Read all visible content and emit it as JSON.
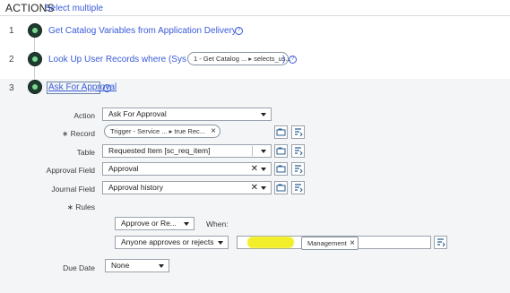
{
  "header": {
    "title": "ACTIONS",
    "select_multiple": "Select multiple"
  },
  "steps": [
    {
      "number": "1",
      "label": "Get Catalog Variables from Application Delivery"
    },
    {
      "number": "2",
      "label": "Look Up User Records where (Sys ID is one of",
      "pill_text": "1 - Get Catalog ... ▸ selects_us...",
      "suffix": ")"
    },
    {
      "number": "3",
      "label": "Ask For Approval"
    }
  ],
  "form": {
    "action": {
      "label": "Action",
      "value": "Ask For Approval"
    },
    "record": {
      "label": "Record",
      "pill": "Trigger - Service ... ▸ true Rec..."
    },
    "table": {
      "label": "Table",
      "value": "Requested Item [sc_req_item]"
    },
    "approval_field": {
      "label": "Approval Field",
      "value": "Approval"
    },
    "journal_field": {
      "label": "Journal Field",
      "value": "Approval history"
    },
    "rules": {
      "label": "Rules",
      "approve_select": "Approve or Re...",
      "when": "When:",
      "condition_select": "Anyone approves or rejects",
      "approver_tag": "Management"
    },
    "due_date": {
      "label": "Due Date",
      "value": "None"
    }
  },
  "icons": {
    "required": "∗",
    "clear": "✕",
    "info": "?",
    "pill_remove": "×"
  },
  "colors": {
    "link": "#3a5bd9",
    "node": "#1f3b2f",
    "node_inner": "#7bd88f",
    "panel": "#f3f5f6",
    "highlight": "#f2ef2a"
  }
}
